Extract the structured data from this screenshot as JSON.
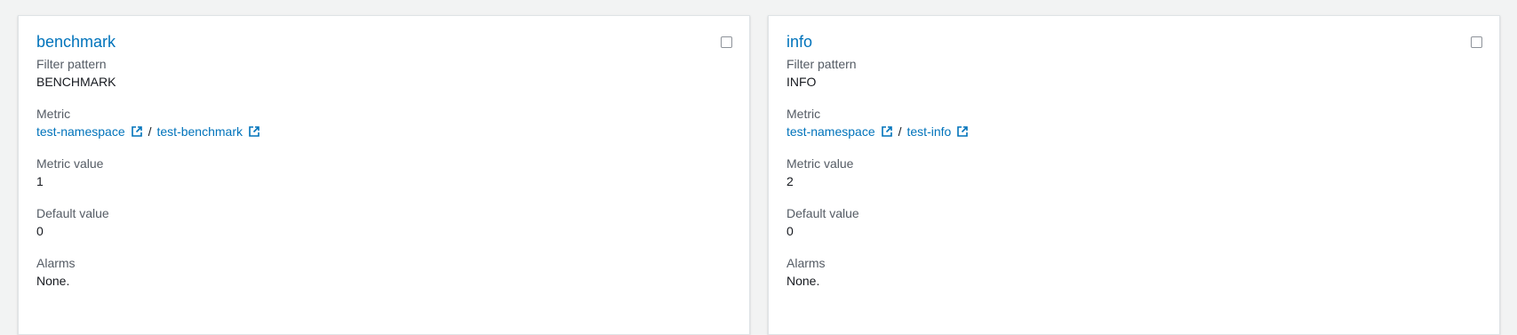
{
  "cards": [
    {
      "title": "benchmark",
      "filter_pattern_label": "Filter pattern",
      "filter_pattern": "BENCHMARK",
      "metric_label": "Metric",
      "metric_namespace": "test-namespace",
      "metric_separator": "/",
      "metric_name": "test-benchmark",
      "metric_value_label": "Metric value",
      "metric_value": "1",
      "default_value_label": "Default value",
      "default_value": "0",
      "alarms_label": "Alarms",
      "alarms": "None."
    },
    {
      "title": "info",
      "filter_pattern_label": "Filter pattern",
      "filter_pattern": "INFO",
      "metric_label": "Metric",
      "metric_namespace": "test-namespace",
      "metric_separator": "/",
      "metric_name": "test-info",
      "metric_value_label": "Metric value",
      "metric_value": "2",
      "default_value_label": "Default value",
      "default_value": "0",
      "alarms_label": "Alarms",
      "alarms": "None."
    }
  ],
  "colors": {
    "link": "#0073bb",
    "label": "#545b64",
    "text": "#16191f",
    "background": "#f2f3f3"
  },
  "icons": {
    "external_link": "external-link-icon",
    "checkbox": "checkbox-unchecked"
  }
}
